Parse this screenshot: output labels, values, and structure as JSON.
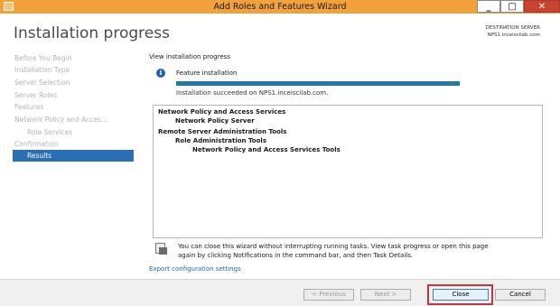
{
  "window": {
    "title": "Add Roles and Features Wizard",
    "controls": {
      "minimize": "_",
      "maximize": "□",
      "close": "✕"
    }
  },
  "header": {
    "page_title": "Installation progress",
    "destination_label": "DESTINATION SERVER",
    "destination_server": "NPS1.inceiscilab.com"
  },
  "sidebar": {
    "items": [
      {
        "label": "Before You Begin"
      },
      {
        "label": "Installation Type"
      },
      {
        "label": "Server Selection"
      },
      {
        "label": "Server Roles"
      },
      {
        "label": "Features"
      },
      {
        "label": "Network Policy and Acces..."
      },
      {
        "label": "Role Services"
      },
      {
        "label": "Confirmation"
      },
      {
        "label": "Results"
      }
    ]
  },
  "main": {
    "section_label": "View installation progress",
    "feature_installation": "Feature installation",
    "progress_fraction": 1.0,
    "status": "Installation succeeded on NPS1.inceiscilab.com.",
    "installed": [
      {
        "label": "Network Policy and Access Services"
      },
      {
        "label": "Network Policy Server"
      },
      {
        "label": "Remote Server Administration Tools"
      },
      {
        "label": "Role Administration Tools"
      },
      {
        "label": "Network Policy and Access Services Tools"
      }
    ],
    "note_line1": "You can close this wizard without interrupting running tasks. View task progress or open this page",
    "note_line2": "again by clicking Notifications in the command bar, and then Task Details.",
    "export_link": "Export configuration settings"
  },
  "footer": {
    "previous": "< Previous",
    "next": "Next >",
    "close": "Close",
    "cancel": "Cancel"
  },
  "colors": {
    "titlebar": "#f3a13b",
    "accent": "#2a6fb4",
    "progress": "#1f79a8",
    "highlight": "#c8343a"
  }
}
